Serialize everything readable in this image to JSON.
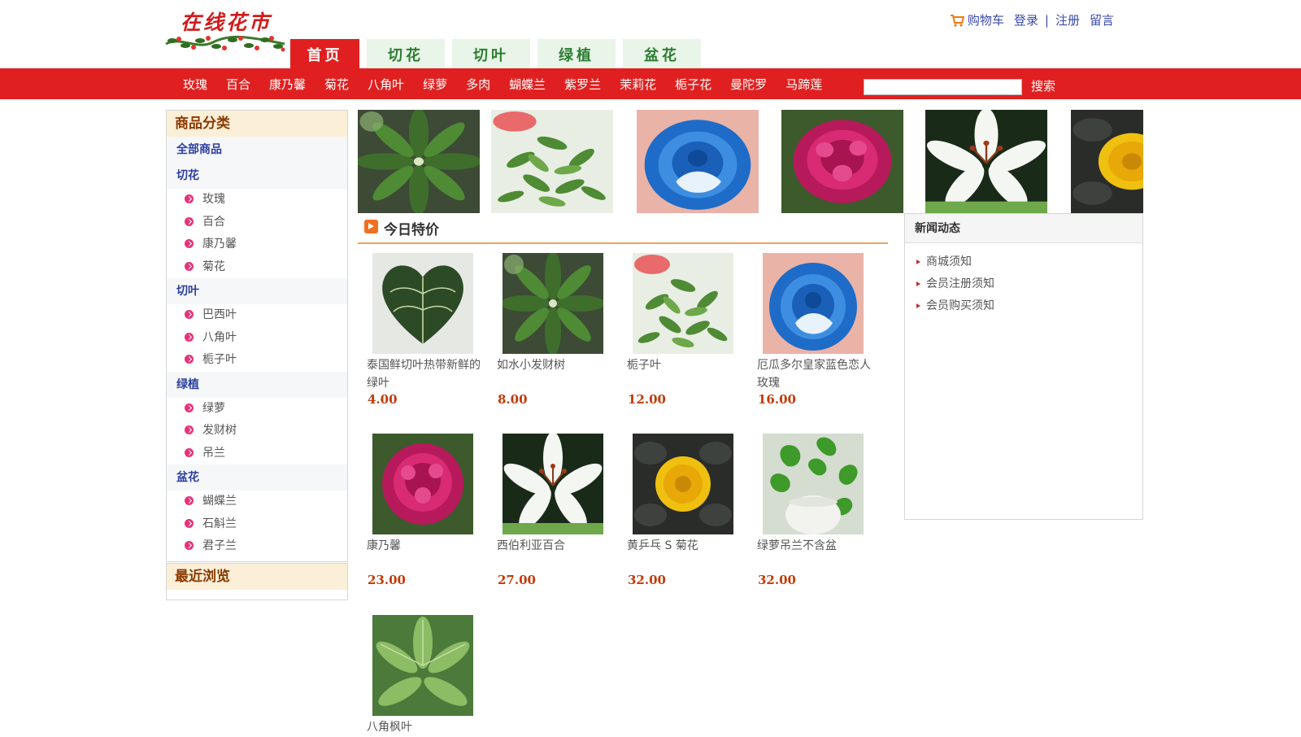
{
  "header": {
    "logo_text": "在线花市",
    "cart": "购物车",
    "login": "登录",
    "sep": "|",
    "register": "注册",
    "message": "留言",
    "tabs": [
      {
        "label": "首页",
        "active": true
      },
      {
        "label": "切花",
        "active": false
      },
      {
        "label": "切叶",
        "active": false
      },
      {
        "label": "绿植",
        "active": false
      },
      {
        "label": "盆花",
        "active": false
      }
    ]
  },
  "nav": {
    "items": [
      "玫瑰",
      "百合",
      "康乃馨",
      "菊花",
      "八角叶",
      "绿萝",
      "多肉",
      "蝴蝶兰",
      "紫罗兰",
      "茉莉花",
      "栀子花",
      "曼陀罗",
      "马蹄莲"
    ],
    "search_placeholder": "",
    "search_button": "搜索"
  },
  "sidebar": {
    "title": "商品分类",
    "all": "全部商品",
    "groups": [
      {
        "name": "切花",
        "items": [
          "玫瑰",
          "百合",
          "康乃馨",
          "菊花"
        ]
      },
      {
        "name": "切叶",
        "items": [
          "巴西叶",
          "八角叶",
          "栀子叶"
        ]
      },
      {
        "name": "绿植",
        "items": [
          "绿萝",
          "发财树",
          "吊兰"
        ]
      },
      {
        "name": "盆花",
        "items": [
          "蝴蝶兰",
          "石斛兰",
          "君子兰"
        ]
      }
    ],
    "recent_title": "最近浏览"
  },
  "news": {
    "title": "新闻动态",
    "items": [
      "商城须知",
      "会员注册须知",
      "会员购买须知"
    ]
  },
  "special": {
    "title": "今日特价",
    "products": [
      {
        "name": "泰国鲜切叶热带新鲜的绿叶",
        "price": "4.00",
        "image": "heart-leaf"
      },
      {
        "name": "如水小发财树",
        "price": "8.00",
        "image": "money-tree"
      },
      {
        "name": "栀子叶",
        "price": "12.00",
        "image": "gardenia-leaf"
      },
      {
        "name": "厄瓜多尔皇家蓝色恋人玫瑰",
        "price": "16.00",
        "image": "blue-rose"
      },
      {
        "name": "康乃馨",
        "price": "23.00",
        "image": "pink-peony"
      },
      {
        "name": "西伯利亚百合",
        "price": "27.00",
        "image": "white-lily"
      },
      {
        "name": "黄乒乓 S 菊花",
        "price": "32.00",
        "image": "yellow-chrysanthemum"
      },
      {
        "name": "绿萝吊兰不含盆",
        "price": "32.00",
        "image": "pothos"
      },
      {
        "name": "八角枫叶",
        "price": "",
        "image": "fatsia-leaf"
      }
    ]
  },
  "banner": {
    "images": [
      "money-tree",
      "gardenia-leaf",
      "blue-rose",
      "pink-peony",
      "white-lily",
      "yellow-chrysanthemum"
    ]
  },
  "colors": {
    "brand_red": "#e02020",
    "tab_green_bg": "#e8f5e8",
    "tab_green_text": "#2e7d32",
    "link_blue": "#3a4aa8",
    "price": "#c23a06",
    "bullet_pink": "#e8317a"
  }
}
